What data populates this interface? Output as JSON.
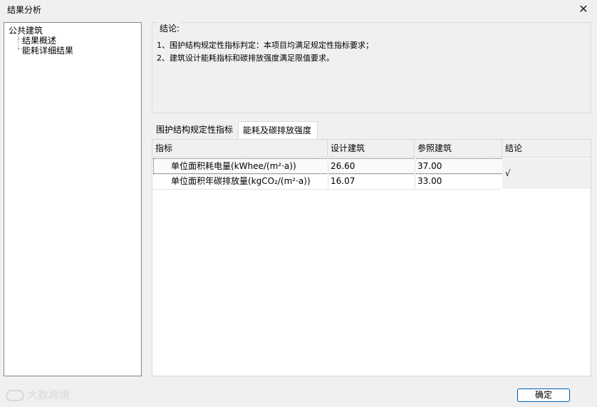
{
  "window": {
    "title": "结果分析",
    "close_glyph": "✕"
  },
  "tree": {
    "root": "公共建筑",
    "children": [
      "结果概述",
      "能耗详细结果"
    ]
  },
  "conclusion": {
    "legend": "结论:",
    "lines": [
      "1、围护结构规定性指标判定：本项目均满足规定性指标要求；",
      "2、建筑设计能耗指标和碳排放强度满足限值要求。"
    ]
  },
  "tabs": [
    {
      "label": "围护结构规定性指标",
      "active": false
    },
    {
      "label": "能耗及碳排放强度",
      "active": true
    }
  ],
  "table": {
    "headers": [
      "指标",
      "设计建筑",
      "参照建筑",
      "结论"
    ],
    "rows": [
      {
        "indicator": "单位面积耗电量(kWhee/(m²·a))",
        "design": "26.60",
        "reference": "37.00"
      },
      {
        "indicator": "单位面积年碳排放量(kgCO₂/(m²·a))",
        "design": "16.07",
        "reference": "33.00"
      }
    ],
    "conclusion_value": "√"
  },
  "ok_button": "确定",
  "watermark": "大数跨境"
}
